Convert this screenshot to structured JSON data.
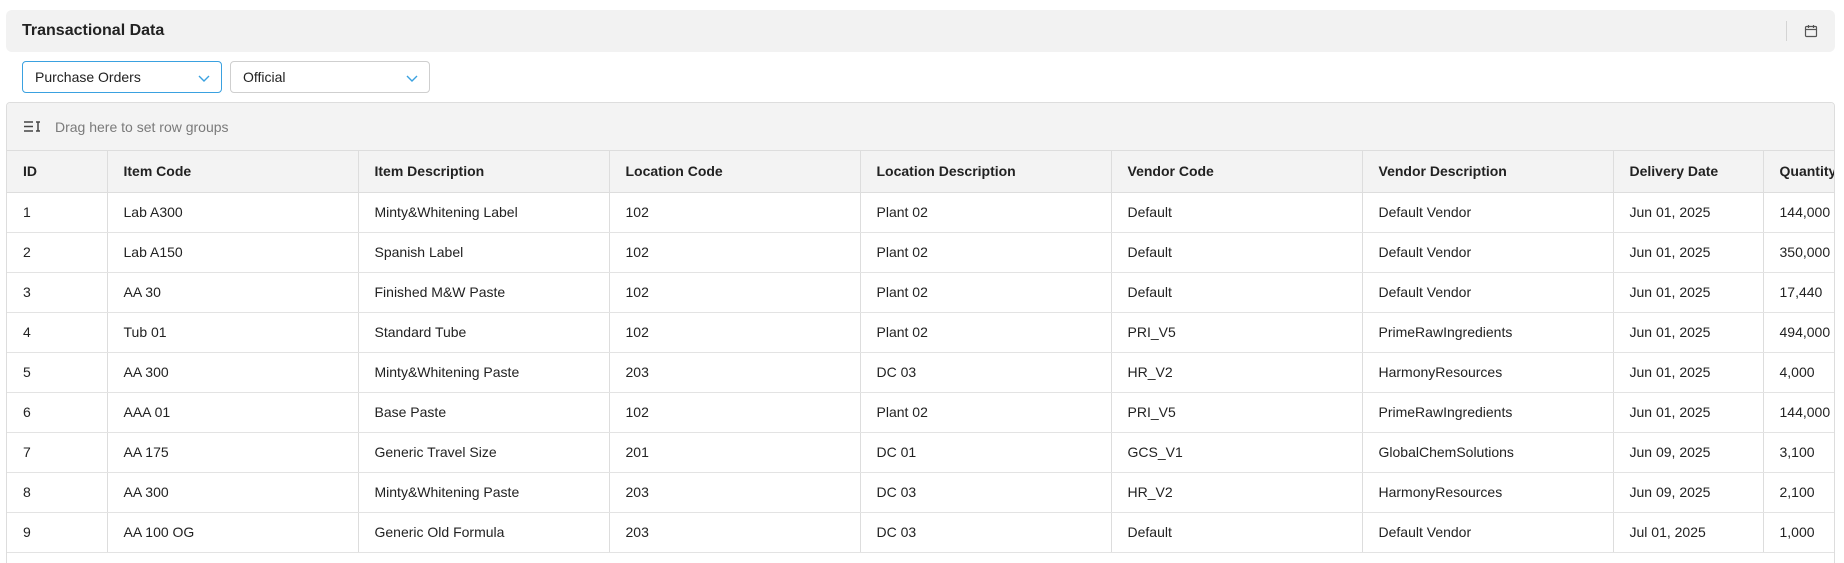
{
  "panel": {
    "title": "Transactional Data"
  },
  "filters": {
    "data_type": "Purchase Orders",
    "version": "Official"
  },
  "grid": {
    "group_panel_text": "Drag here to set row groups",
    "columns": [
      "ID",
      "Item Code",
      "Item Description",
      "Location Code",
      "Location Description",
      "Vendor Code",
      "Vendor Description",
      "Delivery Date",
      "Quantity"
    ],
    "rows": [
      [
        "1",
        "Lab A300",
        "Minty&Whitening Label",
        "102",
        "Plant 02",
        "Default",
        "Default Vendor",
        "Jun 01, 2025",
        "144,000"
      ],
      [
        "2",
        "Lab A150",
        "Spanish Label",
        "102",
        "Plant 02",
        "Default",
        "Default Vendor",
        "Jun 01, 2025",
        "350,000"
      ],
      [
        "3",
        "AA 30",
        "Finished M&W Paste",
        "102",
        "Plant 02",
        "Default",
        "Default Vendor",
        "Jun 01, 2025",
        "17,440"
      ],
      [
        "4",
        "Tub 01",
        "Standard Tube",
        "102",
        "Plant 02",
        "PRI_V5",
        "PrimeRawIngredients",
        "Jun 01, 2025",
        "494,000"
      ],
      [
        "5",
        "AA 300",
        "Minty&Whitening Paste",
        "203",
        "DC 03",
        "HR_V2",
        "HarmonyResources",
        "Jun 01, 2025",
        "4,000"
      ],
      [
        "6",
        "AAA 01",
        "Base Paste",
        "102",
        "Plant 02",
        "PRI_V5",
        "PrimeRawIngredients",
        "Jun 01, 2025",
        "144,000"
      ],
      [
        "7",
        "AA 175",
        "Generic Travel Size",
        "201",
        "DC 01",
        "GCS_V1",
        "GlobalChemSolutions",
        "Jun 09, 2025",
        "3,100"
      ],
      [
        "8",
        "AA 300",
        "Minty&Whitening Paste",
        "203",
        "DC 03",
        "HR_V2",
        "HarmonyResources",
        "Jun 09, 2025",
        "2,100"
      ],
      [
        "9",
        "AA 100 OG",
        "Generic Old Formula",
        "203",
        "DC 03",
        "Default",
        "Default Vendor",
        "Jul 01, 2025",
        "1,000"
      ]
    ]
  },
  "icons": {
    "calendar": "calendar-icon",
    "chevron": "chevron-down-icon",
    "row_group": "row-group-icon"
  },
  "colors": {
    "header_bg": "#f2f2f2",
    "active_border": "#3aa1e0",
    "grid_border": "#dddddd"
  }
}
